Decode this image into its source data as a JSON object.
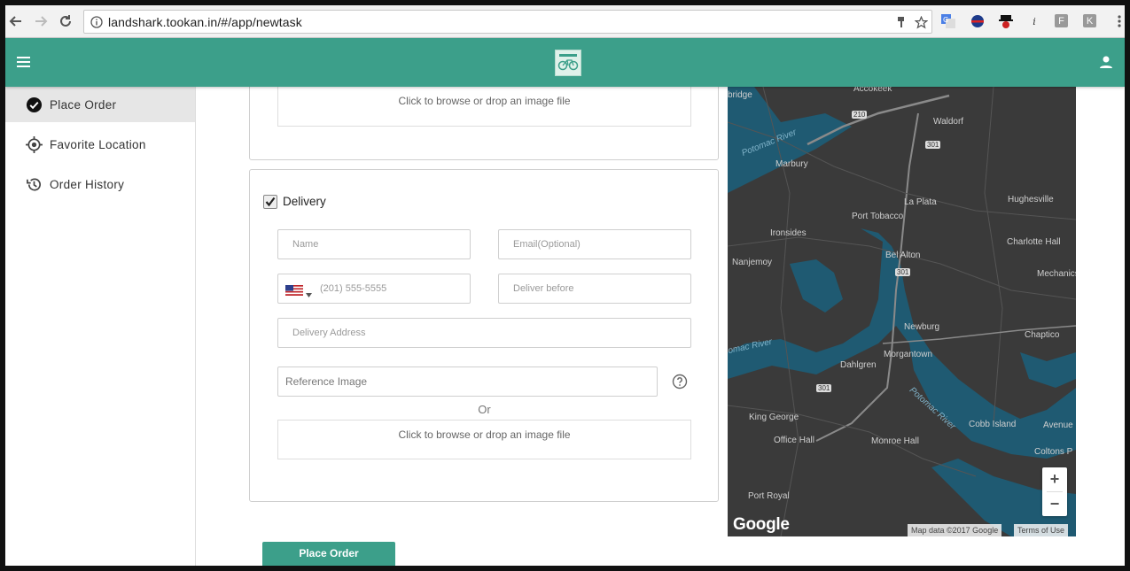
{
  "browser": {
    "url": "landshark.tookan.in/#/app/newtask",
    "extensions": [
      "google-translate",
      "globe",
      "spy",
      "i",
      "F",
      "K"
    ]
  },
  "sidebar": {
    "items": [
      {
        "label": "Place Order",
        "icon": "check-circle-icon",
        "active": true
      },
      {
        "label": "Favorite Location",
        "icon": "location-target-icon",
        "active": false
      },
      {
        "label": "Order History",
        "icon": "history-icon",
        "active": false
      }
    ]
  },
  "pickup": {
    "dropzone_text": "Click to browse or drop an image file"
  },
  "delivery": {
    "checkbox_label": "Delivery",
    "checked": true,
    "name_placeholder": "Name",
    "email_placeholder": "Email(Optional)",
    "phone_placeholder": "(201) 555-5555",
    "deliver_before_placeholder": "Deliver before",
    "address_placeholder": "Delivery Address",
    "reference_image_label": "Reference Image",
    "or_text": "Or",
    "dropzone_text": "Click to browse or drop an image file"
  },
  "actions": {
    "place_order_label": "Place Order"
  },
  "map": {
    "labels": [
      "Accokeek",
      "Waldorf",
      "Marbury",
      "La Plata",
      "Hughesville",
      "Port Tobacco",
      "Ironsides",
      "Charlotte Hall",
      "Nanjemoy",
      "Bel Alton",
      "Mechanics",
      "Newburg",
      "Chaptico",
      "Morgantown",
      "Dahlgren",
      "King George",
      "Cobb Island",
      "Avenue",
      "Office Hall",
      "Monroe Hall",
      "Coltons P",
      "Port Royal",
      "bridge",
      "Potomac River",
      "omac River",
      "Potomac River"
    ],
    "route_shields": [
      "210",
      "301",
      "301",
      "301"
    ],
    "brand": "Google",
    "attribution": "Map data ©2017 Google",
    "terms": "Terms of Use",
    "zoom_in": "+",
    "zoom_out": "−",
    "colors": {
      "land": "#3a3a3a",
      "water": "#1f5a72",
      "road": "#8a8a8a"
    }
  },
  "theme": {
    "primary": "#3c9f8a"
  }
}
